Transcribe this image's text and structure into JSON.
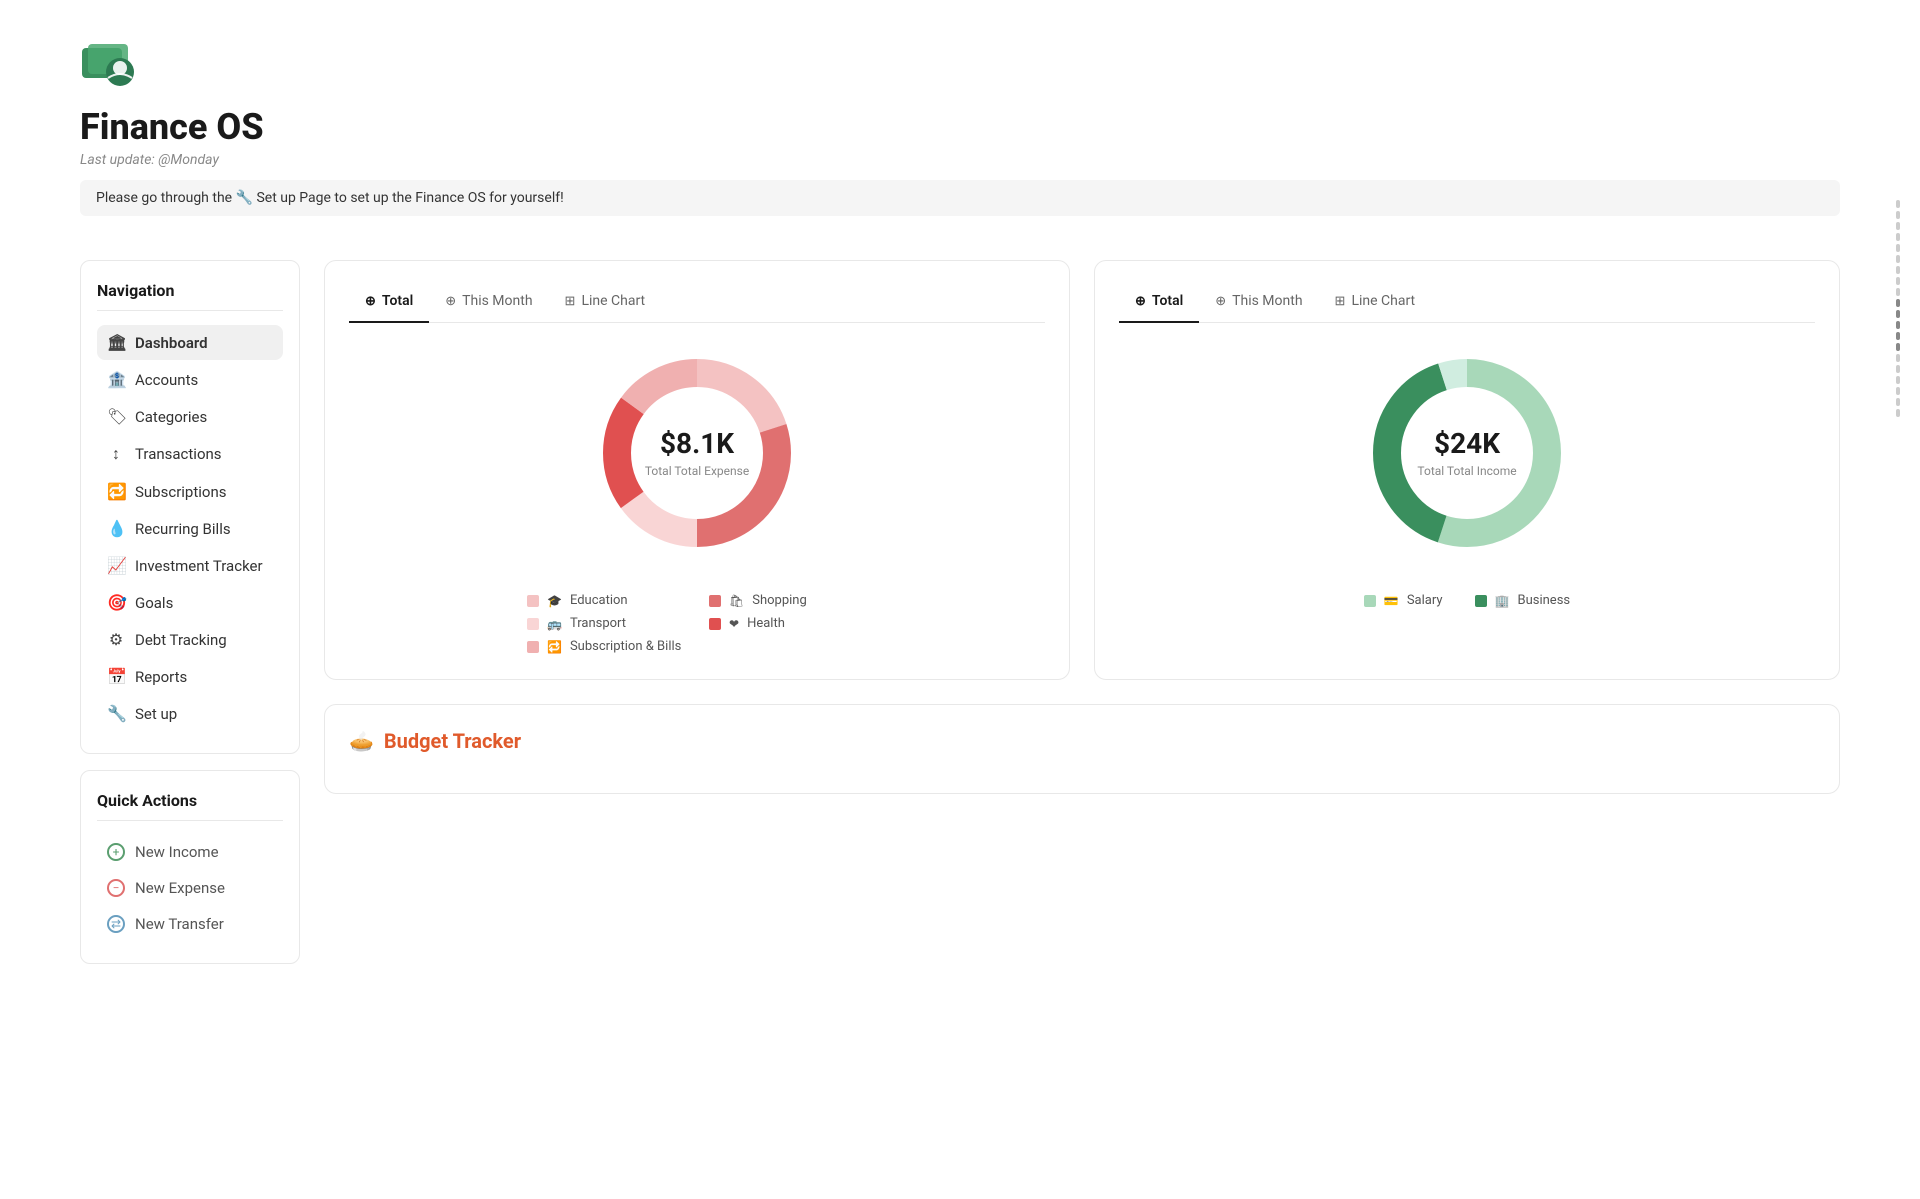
{
  "app": {
    "title": "Finance OS",
    "last_update_label": "Last update:",
    "last_update_value": "@Monday",
    "setup_banner": "Please go through the 🔧 Set up Page to set up the Finance OS for yourself!"
  },
  "navigation": {
    "title": "Navigation",
    "items": [
      {
        "id": "dashboard",
        "label": "Dashboard",
        "icon": "🏛",
        "active": true
      },
      {
        "id": "accounts",
        "label": "Accounts",
        "icon": "🏦",
        "active": false
      },
      {
        "id": "categories",
        "label": "Categories",
        "icon": "🏷",
        "active": false
      },
      {
        "id": "transactions",
        "label": "Transactions",
        "icon": "↕",
        "active": false
      },
      {
        "id": "subscriptions",
        "label": "Subscriptions",
        "icon": "🔁",
        "active": false
      },
      {
        "id": "recurring-bills",
        "label": "Recurring Bills",
        "icon": "💧",
        "active": false
      },
      {
        "id": "investment-tracker",
        "label": "Investment Tracker",
        "icon": "📈",
        "active": false
      },
      {
        "id": "goals",
        "label": "Goals",
        "icon": "🎯",
        "active": false
      },
      {
        "id": "debt-tracking",
        "label": "Debt Tracking",
        "icon": "⚙",
        "active": false
      },
      {
        "id": "reports",
        "label": "Reports",
        "icon": "📅",
        "active": false
      },
      {
        "id": "set-up",
        "label": "Set up",
        "icon": "🔧",
        "active": false
      }
    ]
  },
  "quick_actions": {
    "title": "Quick Actions",
    "items": [
      {
        "id": "new-income",
        "label": "New Income",
        "type": "income"
      },
      {
        "id": "new-expense",
        "label": "New Expense",
        "type": "expense"
      },
      {
        "id": "new-transfer",
        "label": "New Transfer",
        "type": "transfer"
      }
    ]
  },
  "expense_chart": {
    "tabs": [
      {
        "id": "total",
        "label": "Total",
        "icon": "⊕",
        "active": true
      },
      {
        "id": "this-month",
        "label": "This Month",
        "icon": "⊕",
        "active": false
      },
      {
        "id": "line-chart",
        "label": "Line Chart",
        "icon": "⊞",
        "active": false
      }
    ],
    "amount": "$8.1K",
    "label": "Total Total Expense",
    "legend": [
      {
        "label": "Education",
        "icon": "🎓",
        "color": "#f4c2c2"
      },
      {
        "label": "Shopping",
        "icon": "🛍",
        "color": "#e07070"
      },
      {
        "label": "Transport",
        "icon": "🚌",
        "color": "#f9d5d5"
      },
      {
        "label": "Health",
        "icon": "❤",
        "color": "#e05050"
      },
      {
        "label": "Subscription & Bills",
        "icon": "🔁",
        "color": "#f0b0b0"
      }
    ],
    "donut_segments": [
      {
        "color": "#f4c2c2",
        "percent": 20
      },
      {
        "color": "#e07070",
        "percent": 30
      },
      {
        "color": "#f9d5d5",
        "percent": 15
      },
      {
        "color": "#e05050",
        "percent": 20
      },
      {
        "color": "#f0b0b0",
        "percent": 15
      }
    ]
  },
  "income_chart": {
    "tabs": [
      {
        "id": "total",
        "label": "Total",
        "icon": "⊕",
        "active": true
      },
      {
        "id": "this-month",
        "label": "This Month",
        "icon": "⊕",
        "active": false
      },
      {
        "id": "line-chart",
        "label": "Line Chart",
        "icon": "⊞",
        "active": false
      }
    ],
    "amount": "$24K",
    "label": "Total Total Income",
    "legend": [
      {
        "label": "Salary",
        "icon": "💳",
        "color": "#a8d8b9"
      },
      {
        "label": "Business",
        "icon": "🏢",
        "color": "#3a8f5e"
      }
    ],
    "donut_segments": [
      {
        "color": "#a8d8b9",
        "percent": 55
      },
      {
        "color": "#3a8f5e",
        "percent": 40
      },
      {
        "color": "#d0ede0",
        "percent": 5
      }
    ]
  },
  "budget_tracker": {
    "title": "Budget Tracker",
    "icon": "🥧"
  },
  "scrollbar": {
    "ticks": 20
  }
}
